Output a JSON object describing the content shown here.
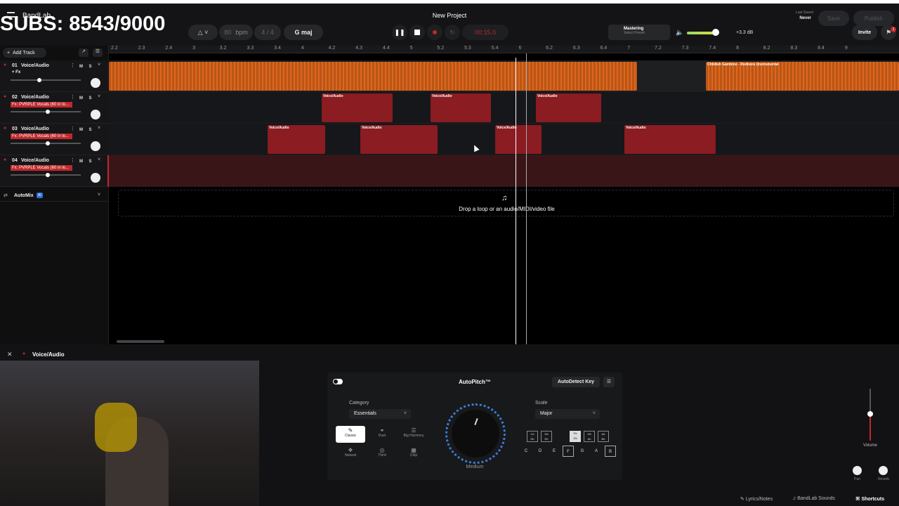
{
  "app": {
    "title": "New Project",
    "logo": "BandLab"
  },
  "overlay": {
    "subs": "SUBS: 8543/9000"
  },
  "topbar": {
    "bpm_value": "80",
    "bpm_label": "bpm",
    "time_sig": "4 / 4",
    "key": "G maj",
    "time": "00:15.0",
    "mastering_label": "Mastering",
    "mastering_preset": "Select Preset",
    "volume_db": "+3.3 dB",
    "last_saved_label": "Last Saved",
    "last_saved_value": "Never",
    "save": "Save",
    "publish": "Publish",
    "invite": "Invite",
    "notif_count": "1"
  },
  "ruler": {
    "ticks": [
      "2.2",
      "2.3",
      "2.4",
      "3",
      "3.2",
      "3.3",
      "3.4",
      "4",
      "4.2",
      "4.3",
      "4.4",
      "5",
      "5.2",
      "5.3",
      "5.4",
      "6",
      "6.2",
      "6.3",
      "6.4",
      "7",
      "7.2",
      "7.3",
      "7.4",
      "8",
      "8.2",
      "8.3",
      "8.4",
      "9"
    ]
  },
  "sidebar": {
    "add_track": "Add Track",
    "automix": "AutoMix",
    "automix_badge": "AI"
  },
  "tracks": [
    {
      "num": "01",
      "name": "Voice/Audio",
      "fx": "+ Fx"
    },
    {
      "num": "02",
      "name": "Voice/Audio",
      "fx": "Fx: PVRPLE Vocals (60 in lo..."
    },
    {
      "num": "03",
      "name": "Voice/Audio",
      "fx": "Fx: PVRPLE Vocals (60 in lo..."
    },
    {
      "num": "04",
      "name": "Voice/Audio",
      "fx": "Fx: PVRPLE Vocals (60 in lo..."
    }
  ],
  "clips": {
    "track1_label": "Childish Gambino - Redbone (Instrumental",
    "voice_label": "Voice/Audio"
  },
  "drop": {
    "text": "Drop a loop or an audio/MIDI/video file"
  },
  "panel": {
    "track_name": "Voice/Audio",
    "title": "AutoPitch™",
    "autodetect": "AutoDetect Key",
    "category_label": "Category",
    "category_value": "Essentials",
    "effects": [
      "Classic",
      "Duet",
      "Big Harmony",
      "Natural",
      "Third",
      "Chip"
    ],
    "knob_label": "Medium",
    "scale_label": "Scale",
    "scale_value": "Major",
    "sharps": [
      "C#\nDb",
      "D#\nEb",
      "F#\nGb",
      "G#\nAb",
      "A#\nBb"
    ],
    "naturals": [
      "C",
      "D",
      "E",
      "F",
      "G",
      "A",
      "B"
    ],
    "volume_label": "Volume",
    "pan_label": "Pan",
    "reverb_label": "Reverb"
  },
  "footer": {
    "lyrics": "Lyrics/Notes",
    "sounds": "BandLab Sounds",
    "shortcuts": "Shortcuts"
  },
  "colors": {
    "accent_red": "#c0282c",
    "clip_orange": "#e0661c",
    "clip_red": "#8a1c22"
  }
}
